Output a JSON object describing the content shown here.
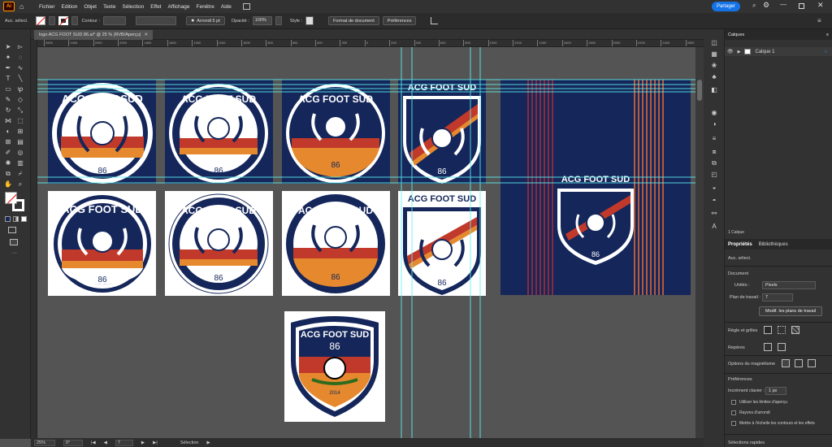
{
  "app": {
    "logo": "Ai"
  },
  "menu": [
    "Fichier",
    "Edition",
    "Objet",
    "Texte",
    "Sélection",
    "Effet",
    "Affichage",
    "Fenêtre",
    "Aide"
  ],
  "share_label": "Partager",
  "control": {
    "selection_label": "Auc. sélect.",
    "stroke_label": "Contour :",
    "brush_label": "Arrondi 5 pt",
    "opacity_label": "Opacité :",
    "opacity_value": "100%",
    "style_label": "Style :",
    "doc_format_btn": "Format de document",
    "prefs_btn": "Préférences"
  },
  "document_tab": "logo ACG FOOT SUD 86.ai* @ 25 % (RVB/Aperçu)",
  "ruler_ticks": [
    "2600",
    "2400",
    "2200",
    "2000",
    "1800",
    "1600",
    "1400",
    "1200",
    "1000",
    "800",
    "600",
    "400",
    "200",
    "0",
    "200",
    "400",
    "600",
    "800",
    "1000",
    "1200",
    "1400",
    "1600",
    "1800",
    "2000",
    "2200",
    "2400",
    "2600"
  ],
  "status": {
    "zoom": "25%",
    "angle": "0°",
    "artboard": "7",
    "mode": "Sélection"
  },
  "layers_panel": {
    "title": "Calques",
    "layer_name": "Calque 1",
    "footer": "1 Calque"
  },
  "properties": {
    "tab1": "Propriétés",
    "tab2": "Bibliothèques",
    "no_selection": "Auc. sélect.",
    "document_title": "Document",
    "units_label": "Unités :",
    "units_value": "Pixels",
    "artboard_label": "Plan de travail :",
    "artboard_value": "7",
    "edit_artboards_btn": "Modif. les plans de travail",
    "rulers_grids": "Règle et grilles",
    "guides": "Repères",
    "snap_options": "Options du magnétisme",
    "preferences_title": "Préférences",
    "keyboard_increment_label": "Incrément clavier :",
    "keyboard_increment_value": "1 px",
    "cb_preview_bounds": "Utiliser les limites d'aperçu",
    "cb_scale_corners": "Rayons d'arrondi",
    "cb_scale_strokes": "Mettre à l'échelle les contours et les effets",
    "quick_actions": "Sélections rapides"
  },
  "logos": {
    "title": "ACG FOOT SUD",
    "number": "86",
    "year": "2014"
  },
  "colors": {
    "navy": "#14265a",
    "red": "#c0392b",
    "orange": "#e6892e",
    "accent_blue": "#1473e6",
    "guide": "#5ff3f3"
  }
}
